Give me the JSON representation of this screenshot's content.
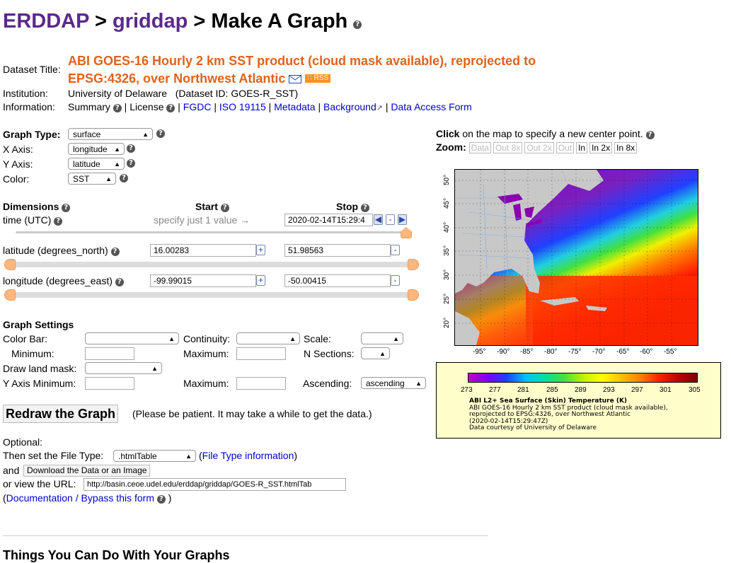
{
  "breadcrumb": {
    "root": "ERDDAP",
    "sep1": ">",
    "middle": "griddap",
    "sep2": ">",
    "current": "Make A Graph"
  },
  "dataset": {
    "title_label": "Dataset Title:",
    "title_line1": "ABI GOES-16 Hourly 2 km SST product (cloud mask available), reprojected to",
    "title_line2": "EPSG:4326, over Northwest Atlantic",
    "rss": "RSS",
    "institution_label": "Institution:",
    "institution": "University of Delaware",
    "dataset_id": "(Dataset ID: GOES-R_SST)",
    "information_label": "Information:",
    "info_links": [
      "Summary",
      "License",
      "FGDC",
      "ISO 19115",
      "Metadata",
      "Background",
      "Data Access Form"
    ]
  },
  "graph": {
    "type_label": "Graph Type:",
    "type_value": "surface",
    "x_label": "X Axis:",
    "x_value": "longitude",
    "y_label": "Y Axis:",
    "y_value": "latitude",
    "color_label": "Color:",
    "color_value": "SST"
  },
  "dimensions": {
    "title": "Dimensions",
    "start_header": "Start",
    "stop_header": "Stop",
    "time_label": "time (UTC)",
    "time_hint": "specify just 1 value →",
    "time_stop": "2020-02-14T15:29:4",
    "lat_label": "latitude (degrees_north)",
    "lat_start": "16.00283",
    "lat_stop": "51.98563",
    "lon_label": "longitude (degrees_east)",
    "lon_start": "-99.99015",
    "lon_stop": "-50.00415"
  },
  "settings": {
    "title": "Graph Settings",
    "color_bar": "Color Bar:",
    "continuity": "Continuity:",
    "scale": "Scale:",
    "minimum": "Minimum:",
    "maximum": "Maximum:",
    "n_sections": "N Sections:",
    "land_mask": "Draw land mask:",
    "y_min": "Y Axis Minimum:",
    "y_max": "Maximum:",
    "ascending_label": "Ascending:",
    "ascending_value": "ascending"
  },
  "redraw": {
    "button": "Redraw the Graph",
    "note": "(Please be patient. It may take a while to get the data.)"
  },
  "optional": {
    "label": "Optional:",
    "file_type_prefix": "Then set the File Type:",
    "file_type_value": ".htmlTable",
    "file_type_link": "File Type information",
    "and": "and",
    "download_button": "Download the Data or an Image",
    "url_prefix": "or view the URL:",
    "url_value": "http://basin.ceoe.udel.edu/erddap/griddap/GOES-R_SST.htmlTab",
    "doc_link": "Documentation / Bypass this form"
  },
  "map": {
    "click_bold": "Click",
    "click_rest": "on the map to specify a new center point.",
    "zoom_label": "Zoom:",
    "zoom_buttons": [
      "Data",
      "Out 8x",
      "Out 2x",
      "Out",
      "In",
      "In 2x",
      "In 8x"
    ],
    "lat_ticks": [
      "50°",
      "45°",
      "40°",
      "35°",
      "30°",
      "25°",
      "20°"
    ],
    "lon_ticks": [
      "-95°",
      "-90°",
      "-85°",
      "-80°",
      "-75°",
      "-70°",
      "-65°",
      "-60°",
      "-55°"
    ]
  },
  "legend": {
    "ticks": [
      "273",
      "277",
      "281",
      "285",
      "289",
      "293",
      "297",
      "301",
      "305"
    ],
    "var_title": "ABI L2+ Sea Surface (Skin) Temperature (K)",
    "line1": "ABI GOES-16 Hourly 2 km SST product (cloud mask available),",
    "line2": "reprojected to EPSG:4326, over Northwest Atlantic",
    "line3": "(2020-02-14T15:29:47Z)",
    "line4": "Data courtesy of University of Delaware"
  },
  "footer_heading": "Things You Can Do With Your Graphs"
}
